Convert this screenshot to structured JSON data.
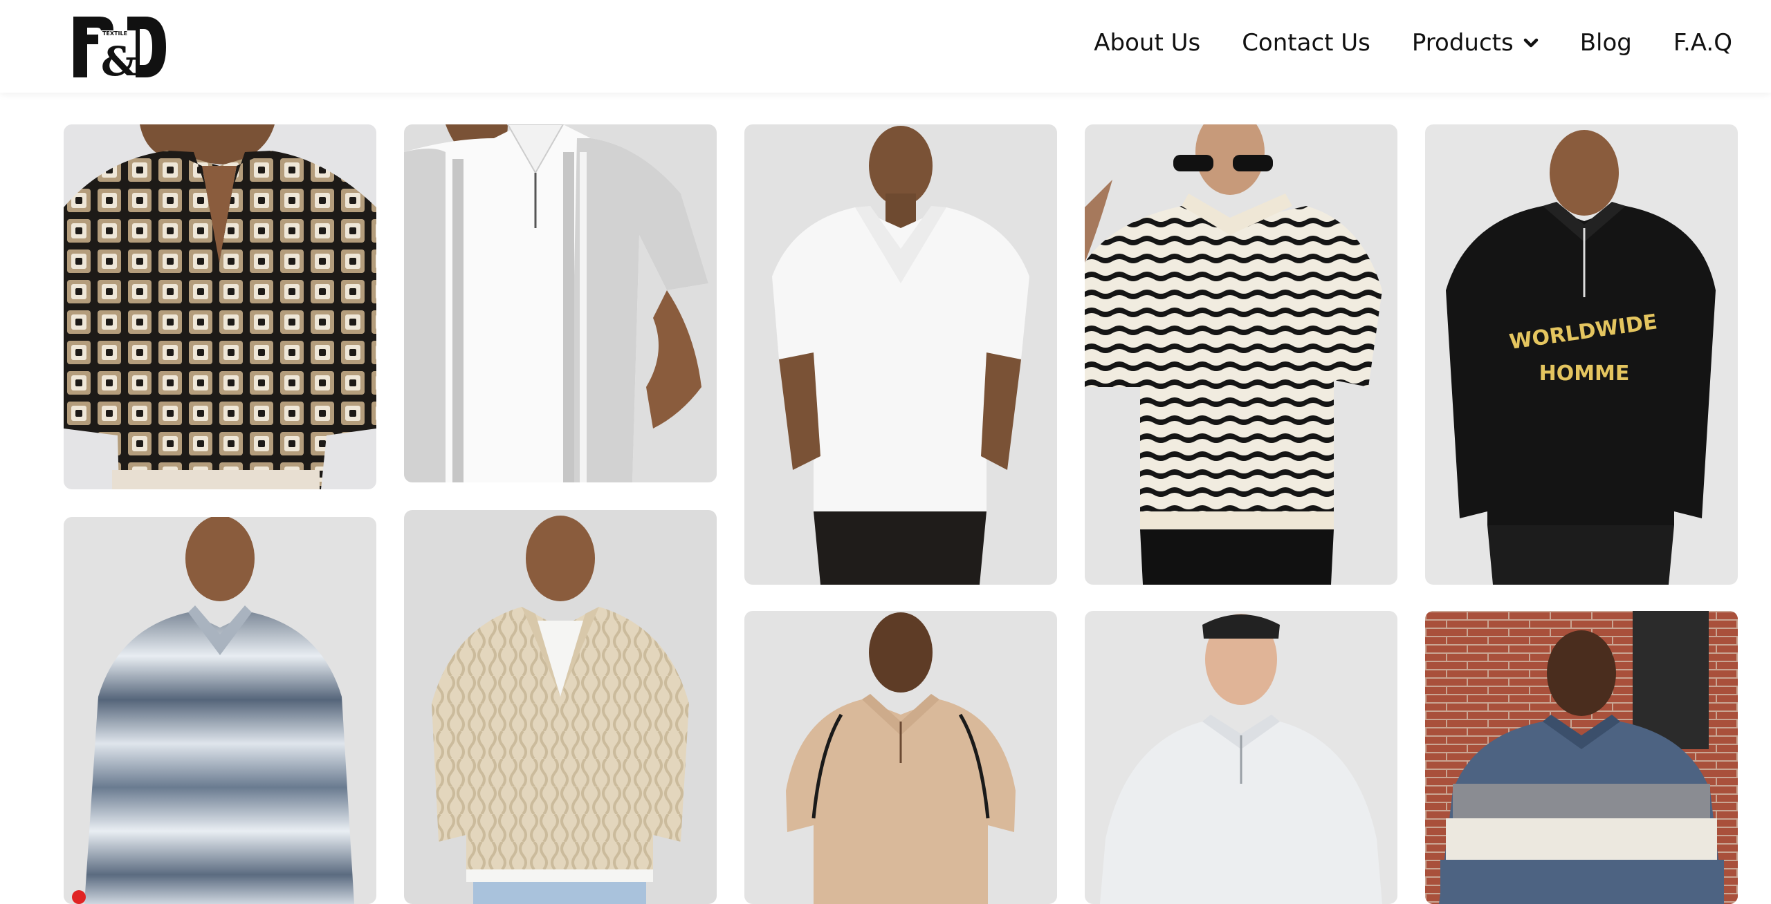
{
  "brand": {
    "logo_text": "P&D",
    "logo_subtext": "TEXTILE"
  },
  "nav": {
    "items": [
      {
        "label": "About Us"
      },
      {
        "label": "Contact Us"
      },
      {
        "label": "Products"
      },
      {
        "label": "Blog"
      },
      {
        "label": "F.A.Q"
      }
    ]
  },
  "gallery": {
    "products": [
      {
        "name": "crochet-pattern-polo",
        "printed_text": ""
      },
      {
        "name": "striped-knit-polo",
        "printed_text": ""
      },
      {
        "name": "white-camp-collar-polo",
        "printed_text": ""
      },
      {
        "name": "black-cream-striped-knit-polo",
        "printed_text": ""
      },
      {
        "name": "black-quarter-zip-sweatshirt",
        "printed_text": "WORLDWIDE HOMME"
      },
      {
        "name": "blue-ombre-knit-polo",
        "printed_text": ""
      },
      {
        "name": "beige-cable-knit-polo",
        "printed_text": ""
      },
      {
        "name": "tan-zip-polo",
        "printed_text": ""
      },
      {
        "name": "grey-zip-polo-sweatshirt",
        "printed_text": ""
      },
      {
        "name": "colorblock-rugby-polo",
        "printed_text": ""
      }
    ]
  }
}
